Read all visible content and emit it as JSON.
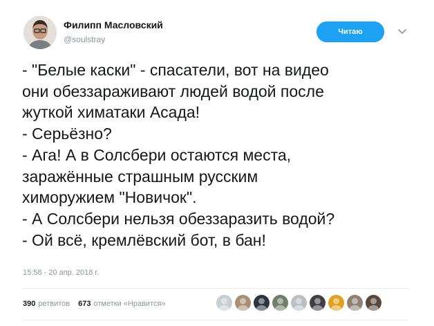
{
  "author": {
    "name": "Филипп Масловский",
    "handle": "@soulstray",
    "avatar_icon": "man-avatar-icon"
  },
  "follow_button": {
    "label": "Читаю"
  },
  "menu_icon": "chevron-down-icon",
  "tweet": {
    "lines": [
      "- \"Белые каски\" - спасатели, вот на видео",
      "они обеззараживают людей водой после",
      "жуткой химатаки Асада!",
      "- Серьёзно?",
      "- Ага! А в Солсбери остаются места,",
      "заражённые страшным русским",
      "химоружием \"Новичок\".",
      "- А Солсбери нельзя обеззаразить водой?",
      "- Ой всё, кремлёвский бот, в бан!"
    ],
    "timestamp": "15:58 - 20 апр. 2018 г."
  },
  "stats": {
    "retweets_count": "390",
    "retweets_label": "ретвитов",
    "likes_count": "673",
    "likes_label": "отметки «Нравится»"
  },
  "likers": [
    {
      "name": "liker-avatar-1",
      "bg": "#c9ced3"
    },
    {
      "name": "liker-avatar-2",
      "bg": "#a98e74"
    },
    {
      "name": "liker-avatar-3",
      "bg": "#2c3440"
    },
    {
      "name": "liker-avatar-4",
      "bg": "#6f7f6a"
    },
    {
      "name": "liker-avatar-5",
      "bg": "#b9bfc5"
    },
    {
      "name": "liker-avatar-6",
      "bg": "#3f3f44"
    },
    {
      "name": "liker-avatar-7",
      "bg": "#e0a020"
    },
    {
      "name": "liker-avatar-8",
      "bg": "#8e8277"
    },
    {
      "name": "liker-avatar-9",
      "bg": "#5a4a3e"
    }
  ],
  "colors": {
    "accent": "#1da1f2",
    "text": "#14171a",
    "muted": "#8a959e",
    "divider": "#e6ecf0"
  }
}
